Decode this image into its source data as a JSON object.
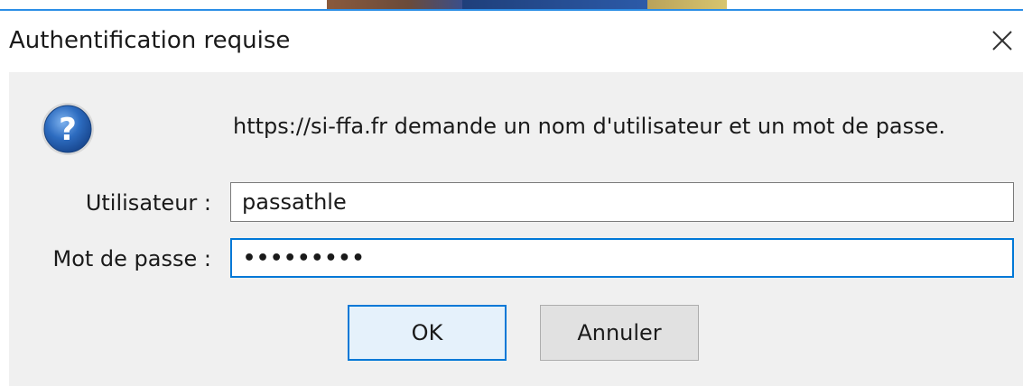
{
  "window": {
    "title": "Authentification requise",
    "close_glyph": "×"
  },
  "dialog": {
    "icon": "question-icon",
    "message": "https://si-ffa.fr demande un nom d'utilisateur et un mot de passe.",
    "user_label": "Utilisateur :",
    "user_value": "passathle",
    "password_label": "Mot de passe :",
    "password_mask": "•••••••••",
    "ok_label": "OK",
    "cancel_label": "Annuler"
  },
  "colors": {
    "accent": "#0078d7",
    "dialog_bg": "#f0f0f0",
    "icon_blue": "#2d6cc0"
  }
}
